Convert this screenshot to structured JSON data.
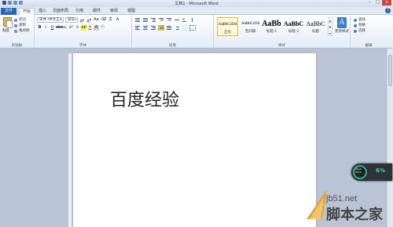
{
  "window": {
    "title": "文档1 - Microsoft Word"
  },
  "tabs": [
    {
      "label": "文件"
    },
    {
      "label": "开始"
    },
    {
      "label": "插入"
    },
    {
      "label": "页面布局"
    },
    {
      "label": "引用"
    },
    {
      "label": "邮件"
    },
    {
      "label": "审阅"
    },
    {
      "label": "视图"
    }
  ],
  "ribbon": {
    "clipboard": {
      "paste_label": "粘贴",
      "cut_label": "剪切",
      "copy_label": "复制",
      "format_painter_label": "格式刷",
      "group_label": "剪贴板"
    },
    "font": {
      "font_name": "宋体 (中文正)",
      "font_size": "初号",
      "group_label": "字体"
    },
    "paragraph": {
      "group_label": "段落"
    },
    "styles": {
      "items": [
        {
          "sample": "AaBbCcDd",
          "name": "正文",
          "selected": true
        },
        {
          "sample": "AaBbCcDd",
          "name": "无间隔",
          "selected": false
        },
        {
          "sample": "AaBb",
          "name": "标题 1",
          "selected": false
        },
        {
          "sample": "AaBbC",
          "name": "标题 2",
          "selected": false
        },
        {
          "sample": "AaBbC",
          "name": "标题",
          "selected": false
        }
      ],
      "change_styles_label": "更改样式",
      "group_label": "样式"
    },
    "editing": {
      "find_label": "查找",
      "replace_label": "替换",
      "select_label": "选择",
      "group_label": "编辑"
    }
  },
  "document": {
    "text": "百度经验"
  },
  "overlay": {
    "percent": "6%",
    "rate_up": "0K/s",
    "rate_down": "0K/s"
  },
  "watermark": {
    "url": "jb51.net",
    "name": "脚本之家"
  },
  "colors": {
    "file_tab": "#2b63b5",
    "accent_green": "#3ed68e"
  }
}
